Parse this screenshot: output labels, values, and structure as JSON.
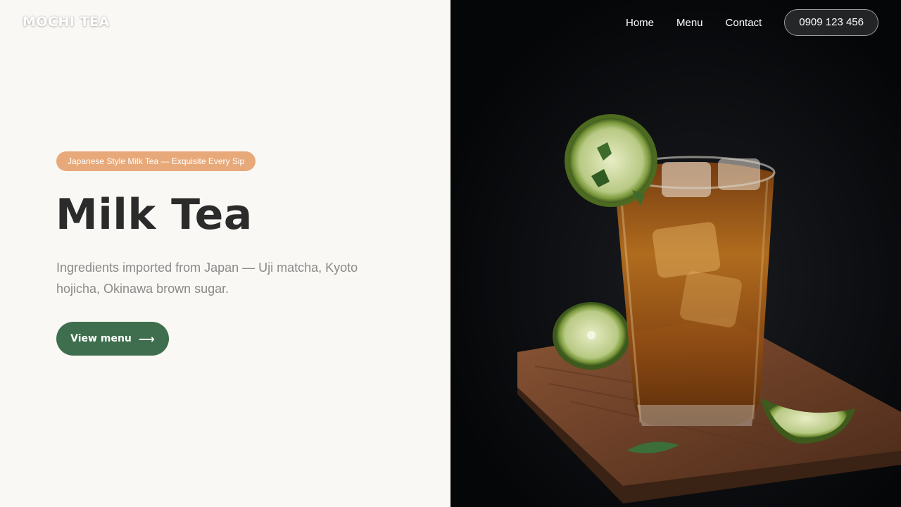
{
  "brand": {
    "name": "MOCHI TEA"
  },
  "nav": {
    "items": [
      {
        "label": "Home"
      },
      {
        "label": "Menu"
      },
      {
        "label": "Contact"
      }
    ],
    "phone": "0909 123 456"
  },
  "hero": {
    "badge": "Japanese Style Milk Tea — Exquisite Every Sip",
    "title": "Milk Tea",
    "description": "Ingredients imported from Japan — Uji matcha, Kyoto hojicha, Okinawa brown sugar.",
    "cta_label": "View menu",
    "cta_icon": "arrow-right-icon",
    "colors": {
      "badge": "#e8a97a",
      "cta": "#3e6e4d",
      "title": "#2b2b2b"
    }
  },
  "image": {
    "subject": "iced-tea-glass-with-lime"
  }
}
